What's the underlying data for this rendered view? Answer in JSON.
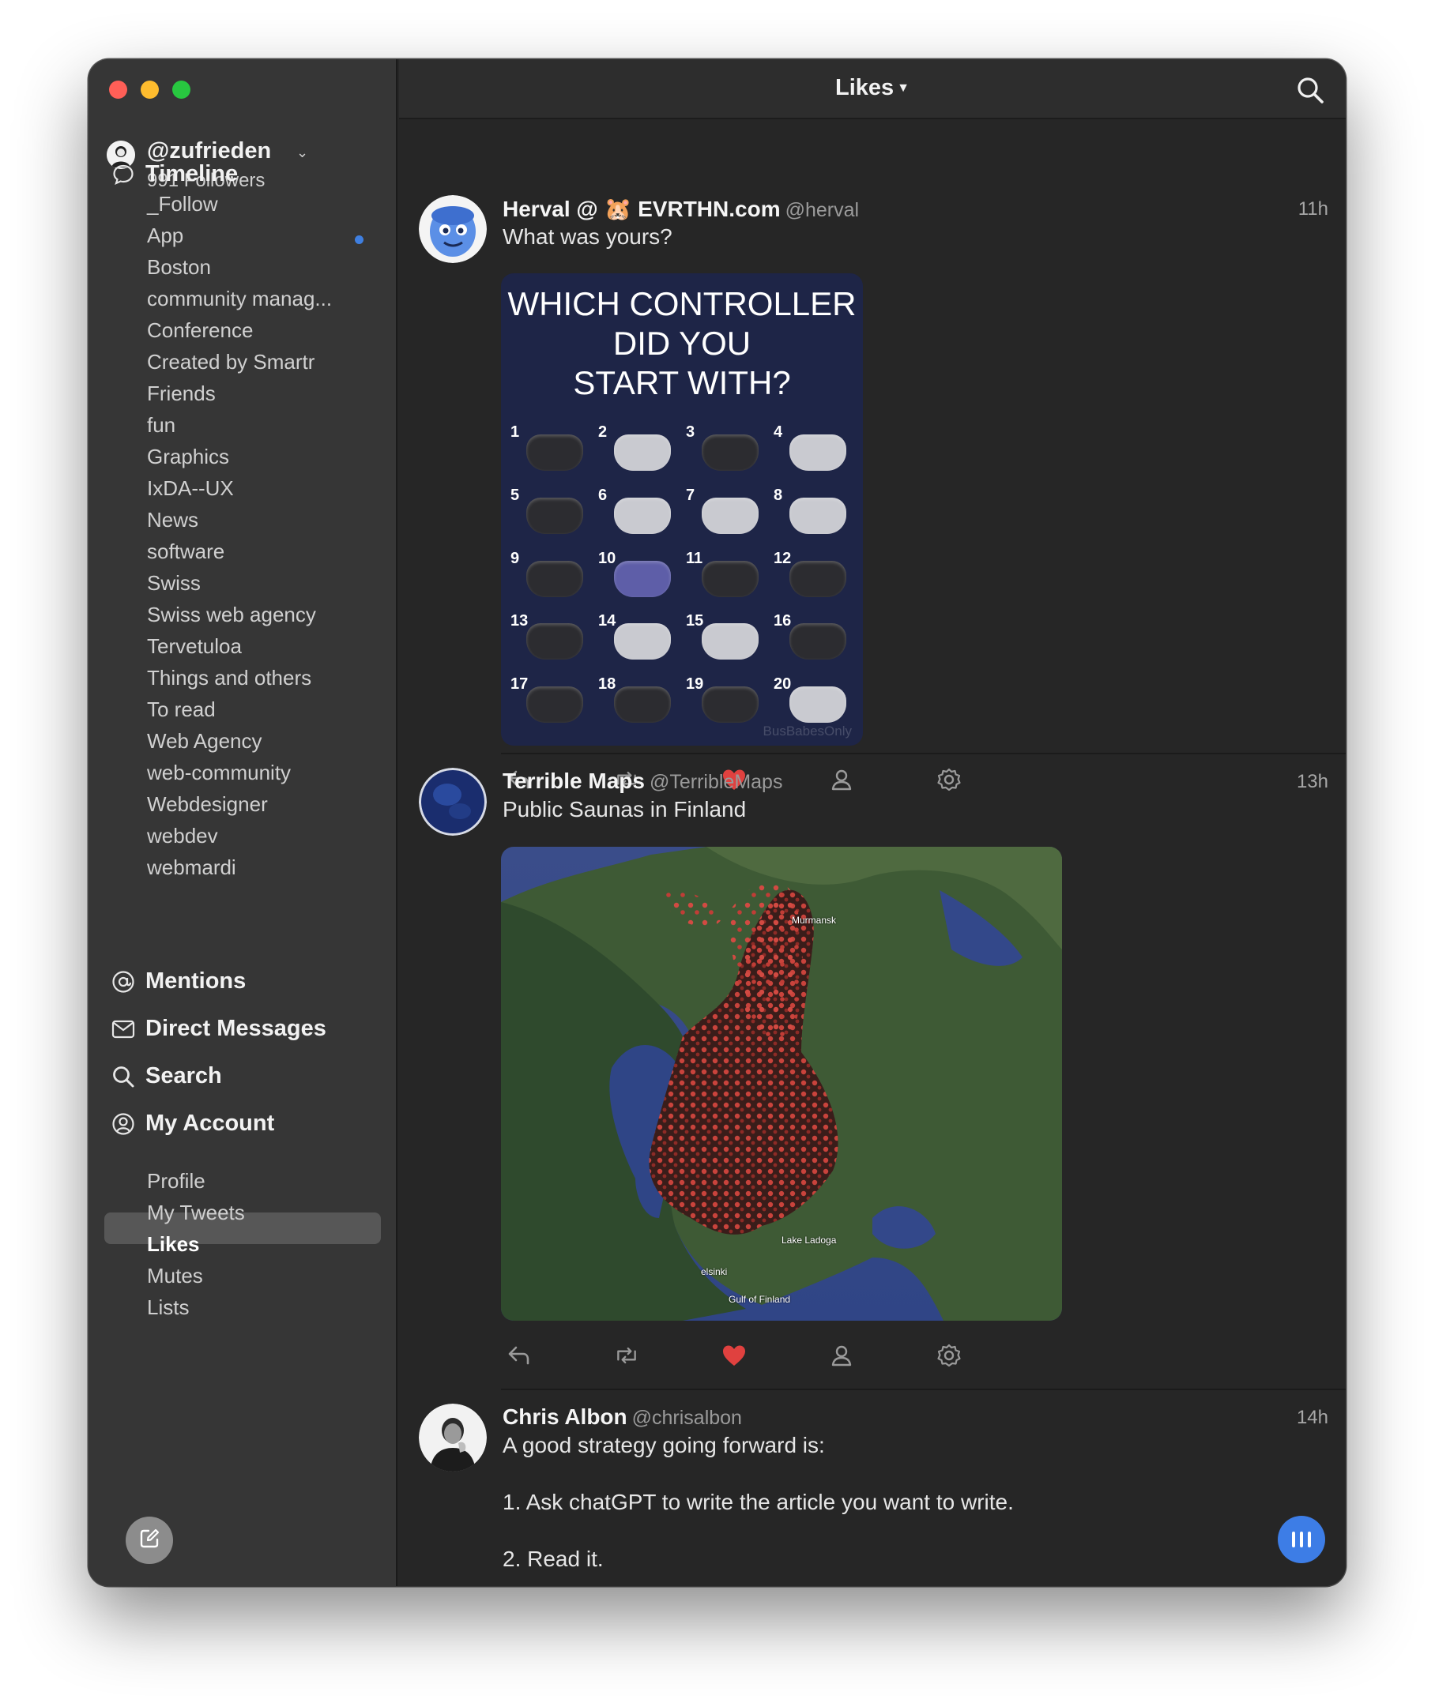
{
  "account": {
    "handle": "@zufrieden",
    "followers": "991 Followers"
  },
  "nav": {
    "timeline": {
      "label": "Timeline",
      "lists": [
        "_Follow",
        "App",
        "Boston",
        "community manag...",
        "Conference",
        "Created by Smartr",
        "Friends",
        "fun",
        "Graphics",
        "IxDA--UX",
        "News",
        "software",
        "Swiss",
        "Swiss web agency",
        "Tervetuloa",
        "Things and others",
        "To read",
        "Web Agency",
        "web-community",
        "Webdesigner",
        "webdev",
        "webmardi"
      ]
    },
    "mentions": "Mentions",
    "direct_messages": "Direct Messages",
    "search": "Search",
    "my_account": {
      "label": "My Account",
      "items": [
        "Profile",
        "My Tweets",
        "Likes",
        "Mutes",
        "Lists"
      ],
      "selected": "Likes"
    }
  },
  "header": {
    "title": "Likes"
  },
  "tweets": [
    {
      "name": "Herval @ 🐹 EVRTHN.com",
      "handle": "@herval",
      "time": "11h",
      "text": "What was yours?",
      "media": {
        "title_lines": [
          "WHICH CONTROLLER",
          "DID YOU",
          "START WITH?"
        ],
        "numbers": [
          "1",
          "2",
          "3",
          "4",
          "5",
          "6",
          "7",
          "8",
          "9",
          "10",
          "11",
          "12",
          "13",
          "14",
          "15",
          "16",
          "17",
          "18",
          "19",
          "20"
        ],
        "watermark": "BusBabesOnly"
      },
      "liked": true
    },
    {
      "name": "Terrible Maps",
      "handle": "@TerribleMaps",
      "time": "13h",
      "text": "Public Saunas in Finland",
      "media": {
        "labels": [
          "Murmansk",
          "Lake Ladoga",
          "elsinki",
          "Gulf of Finland"
        ]
      },
      "liked": true
    },
    {
      "name": "Chris Albon",
      "handle": "@chrisalbon",
      "time": "14h",
      "lines": [
        "A good strategy going forward is:",
        "1. Ask chatGPT to write the article you want to write.",
        "2. Read it."
      ]
    }
  ],
  "colors": {
    "accent": "#3d7de6",
    "like": "#e0413f",
    "sidebar_bg": "#363636",
    "main_bg": "#262626"
  }
}
